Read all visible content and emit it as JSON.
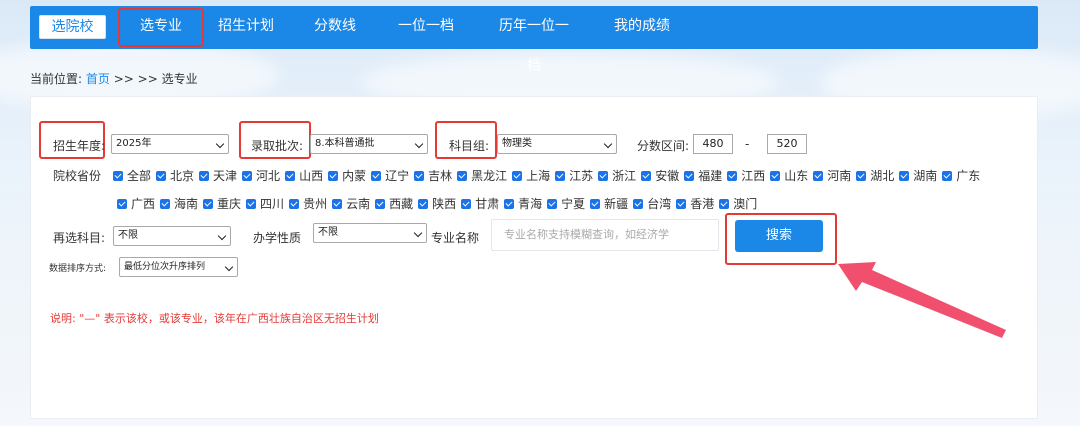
{
  "nav": {
    "items": [
      "选院校",
      "选专业",
      "招生计划",
      "分数线",
      "一位一档",
      "历年一位一档",
      "我的成绩"
    ]
  },
  "breadcrumb": {
    "prefix": "当前位置:",
    "home": "首页",
    "trail": ">> >> 选专业"
  },
  "filters": {
    "year_label": "招生年度:",
    "year_value": "2025年",
    "batch_label": "录取批次:",
    "batch_value": "8.本科普通批",
    "subject_group_label": "科目组:",
    "subject_group_value": "物理类",
    "score_range_label": "分数区间:",
    "score_min": "480",
    "score_sep": "-",
    "score_max": "520",
    "province_label": "院校省份",
    "provinces_row1": [
      "全部",
      "北京",
      "天津",
      "河北",
      "山西",
      "内蒙",
      "辽宁",
      "吉林",
      "黑龙江",
      "上海",
      "江苏",
      "浙江",
      "安徽",
      "福建",
      "江西",
      "山东",
      "河南",
      "湖北",
      "湖南",
      "广东"
    ],
    "provinces_row2": [
      "广西",
      "海南",
      "重庆",
      "四川",
      "贵州",
      "云南",
      "西藏",
      "陕西",
      "甘肃",
      "青海",
      "宁夏",
      "新疆",
      "台湾",
      "香港",
      "澳门"
    ],
    "reselect_label": "再选科目:",
    "reselect_value": "不限",
    "nature_label": "办学性质",
    "nature_value": "不限",
    "major_label": "专业名称",
    "major_placeholder": "专业名称支持模糊查询，如经济学",
    "search_button": "搜索",
    "sort_label": "数据排序方式:",
    "sort_value": "最低分位次升序排列"
  },
  "note": "说明: \"—\" 表示该校，或该专业，该年在广西壮族自治区无招生计划",
  "colors": {
    "primary": "#1b87e6",
    "highlight_red": "#e53935",
    "checkbox": "#1a73e8",
    "arrow": "#f0506e"
  }
}
